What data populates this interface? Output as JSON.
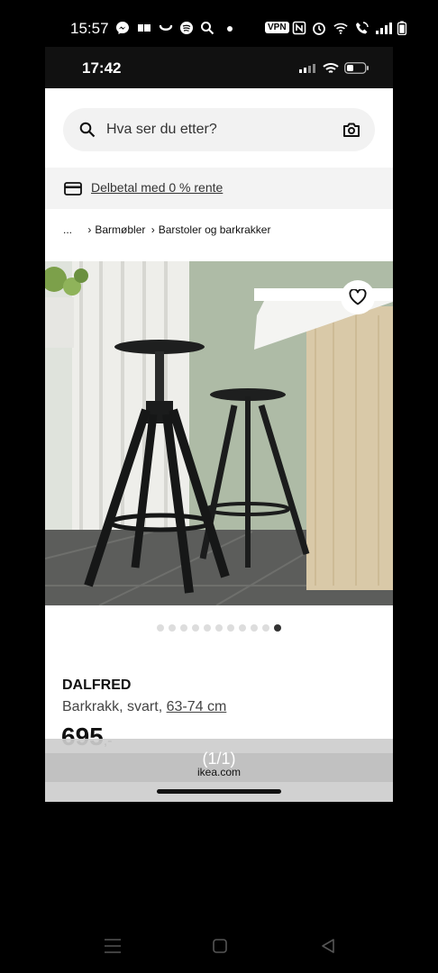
{
  "outer_status": {
    "time": "15:57",
    "vpn_label": "VPN",
    "icons": [
      "messenger-icon",
      "cards-icon",
      "smile-icon",
      "spotify-icon",
      "search-icon",
      "dot-icon",
      "nfc-icon",
      "alarm-icon",
      "wifi-icon",
      "wifi-call-icon",
      "signal-icon",
      "battery-icon"
    ]
  },
  "inner_status": {
    "time": "17:42",
    "icons": [
      "signal-icon",
      "wifi-icon",
      "battery-icon"
    ]
  },
  "search": {
    "placeholder": "Hva ser du etter?",
    "icons": [
      "search-icon",
      "camera-icon"
    ]
  },
  "banner": {
    "label": "Delbetal med 0 % rente",
    "icon": "credit-card-icon"
  },
  "breadcrumb": {
    "items": [
      "...",
      "Barmøbler",
      "Barstoler og barkrakker"
    ]
  },
  "gallery": {
    "dot_count": 11,
    "active_index": 10,
    "favorite_icon": "heart-icon"
  },
  "product": {
    "name": "DALFRED",
    "description": "Barkrakk, svart,",
    "size": "63-74 cm",
    "price": "695",
    "price_suffix": ",-"
  },
  "browser_overlay": {
    "pager": "(1/1)",
    "domain": "ikea.com"
  },
  "nav_bar": {
    "icons": [
      "menu-icon",
      "home-icon",
      "back-icon"
    ]
  },
  "colors": {
    "background": "#000000",
    "screen": "#ffffff",
    "search_bg": "#f2f2f2",
    "active_dot": "#333333"
  }
}
